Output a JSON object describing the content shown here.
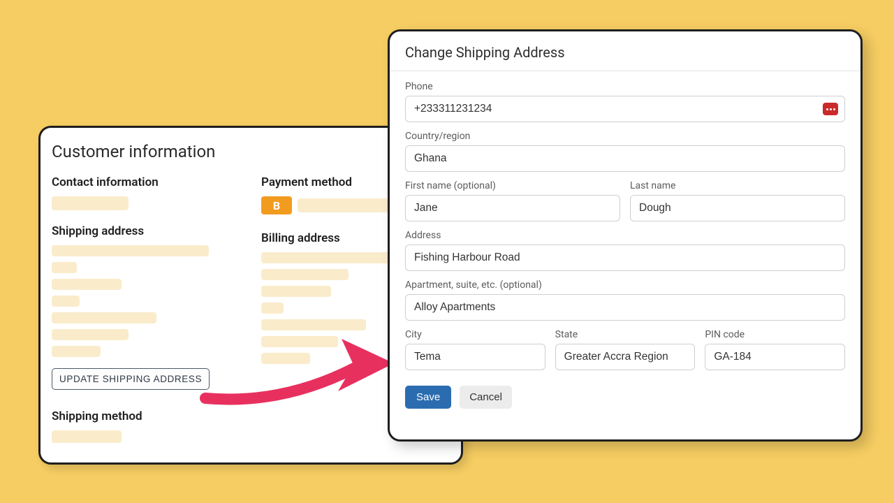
{
  "back_panel": {
    "title": "Customer information",
    "contact_heading": "Contact information",
    "payment_heading": "Payment method",
    "shipping_addr_heading": "Shipping address",
    "billing_addr_heading": "Billing address",
    "shipping_method_heading": "Shipping method",
    "update_button": "UPDATE SHIPPING ADDRESS",
    "payment_badge": "B"
  },
  "dialog": {
    "title": "Change Shipping Address",
    "labels": {
      "phone": "Phone",
      "country": "Country/region",
      "first_name": "First name (optional)",
      "last_name": "Last name",
      "address": "Address",
      "apartment": "Apartment, suite, etc. (optional)",
      "city": "City",
      "state": "State",
      "pin": "PIN code"
    },
    "values": {
      "phone": "+233311231234",
      "country": "Ghana",
      "first_name": "Jane",
      "last_name": "Dough",
      "address": "Fishing Harbour Road",
      "apartment": "Alloy Apartments",
      "city": "Tema",
      "state": "Greater Accra Region",
      "pin": "GA-184"
    },
    "save_label": "Save",
    "cancel_label": "Cancel"
  }
}
